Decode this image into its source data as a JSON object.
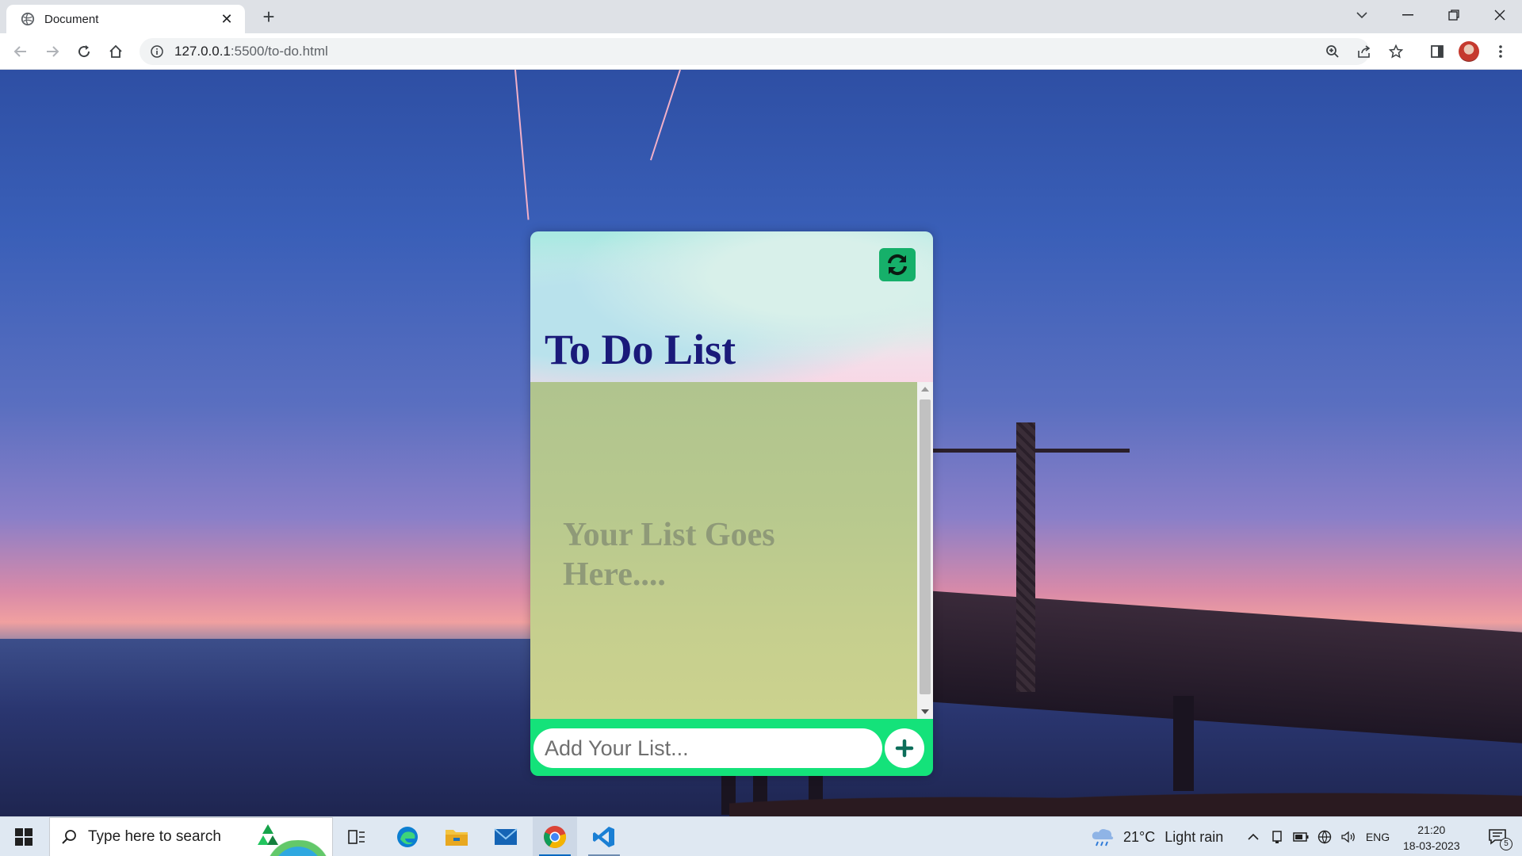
{
  "browser": {
    "tab_title": "Document",
    "tab_close": "✕",
    "new_tab": "+",
    "url_host": "127.0.0.1",
    "url_rest": ":5500/to-do.html"
  },
  "app": {
    "title": "To Do List",
    "placeholder_list": "Your List Goes Here....",
    "input_placeholder": "Add Your List...",
    "colors": {
      "title": "#1a1a7a",
      "accent": "#14e27a",
      "refresh": "#16b06a"
    }
  },
  "taskbar": {
    "search_placeholder": "Type here to search",
    "weather_temp": "21°C",
    "weather_desc": "Light rain",
    "language": "ENG",
    "time": "21:20",
    "date": "18-03-2023",
    "notification_count": "5"
  }
}
